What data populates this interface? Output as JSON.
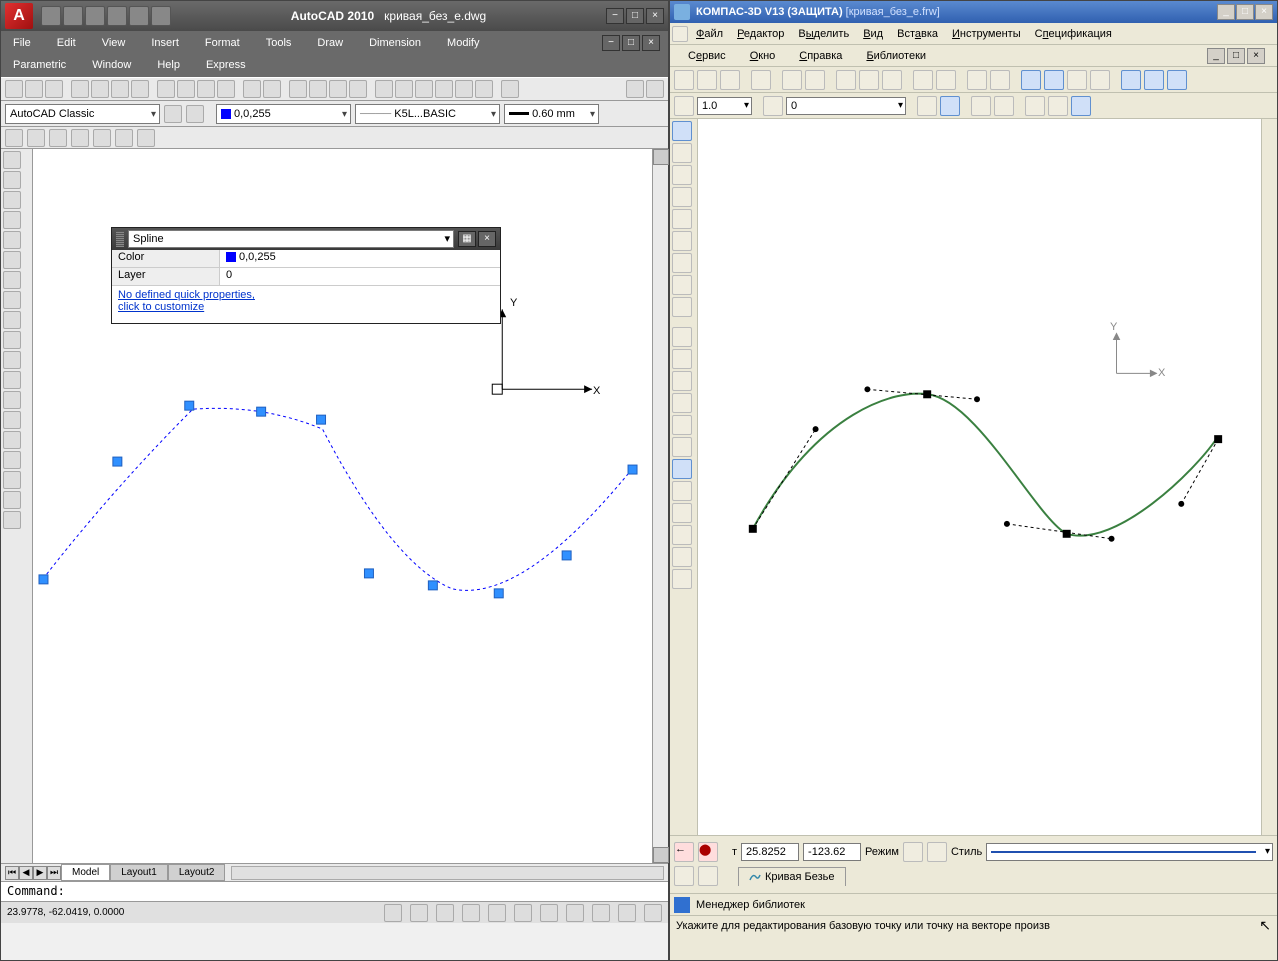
{
  "autocad": {
    "app_name": "AutoCAD 2010",
    "doc_name": "кривая_без_e.dwg",
    "menus_row1": [
      "File",
      "Edit",
      "View",
      "Insert",
      "Format",
      "Tools",
      "Draw",
      "Dimension",
      "Modify"
    ],
    "menus_row2": [
      "Parametric",
      "Window",
      "Help",
      "Express"
    ],
    "workspace": "AutoCAD Classic",
    "color_value": "0,0,255",
    "linetype": "K5L...BASIC",
    "lineweight": "0.60 mm",
    "tabs": [
      "Model",
      "Layout1",
      "Layout2"
    ],
    "command_prompt": "Command:",
    "status_coords": "23.9778, -62.0419, 0.0000",
    "axis_x": "X",
    "axis_y": "Y",
    "qp": {
      "type": "Spline",
      "color_label": "Color",
      "color_value": "0,0,255",
      "layer_label": "Layer",
      "layer_value": "0",
      "link1": "No defined quick properties,",
      "link2": "click to customize"
    }
  },
  "kompas": {
    "app_name": "КОМПАС-3D V13 (ЗАЩИТА)",
    "doc_name": "[кривая_без_e.frw]",
    "menus_row1": [
      "Файл",
      "Редактор",
      "Выделить",
      "Вид",
      "Вставка",
      "Инструменты",
      "Спецификация"
    ],
    "menus_row2": [
      "Сервис",
      "Окно",
      "Справка",
      "Библиотеки"
    ],
    "scale": "1.0",
    "state": "0",
    "axis_x": "X",
    "axis_y": "Y",
    "props": {
      "coord_label": "т",
      "x": "25.8252",
      "y": "-123.62",
      "mode_label": "Режим",
      "style_label": "Стиль",
      "tab_label": "Кривая Безье"
    },
    "lib_label": "Менеджер библиотек",
    "status_text": "Укажите для редактирования базовую точку или точку на векторе произв"
  }
}
